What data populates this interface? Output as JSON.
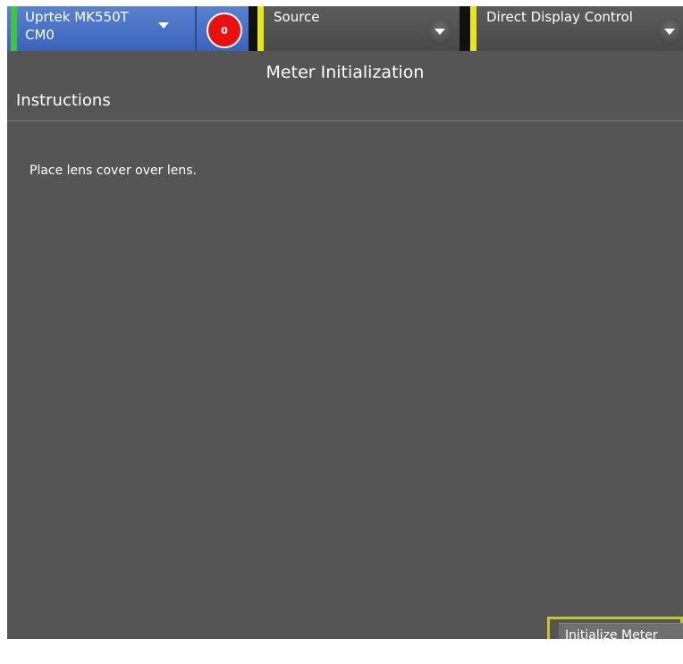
{
  "meter": {
    "name_line1": "Uprtek MK550T",
    "name_line2": "CM0",
    "status_color": "#3ec63e",
    "error_count": "0"
  },
  "source": {
    "label": "Source",
    "status_color": "#e6e61e"
  },
  "display": {
    "label": "Direct Display Control",
    "status_color": "#e6e61e"
  },
  "page": {
    "title": "Meter Initialization",
    "instructions_heading": "Instructions",
    "instruction_text": "Place lens cover over lens."
  },
  "actions": {
    "initialize_label": "Initialize Meter"
  }
}
